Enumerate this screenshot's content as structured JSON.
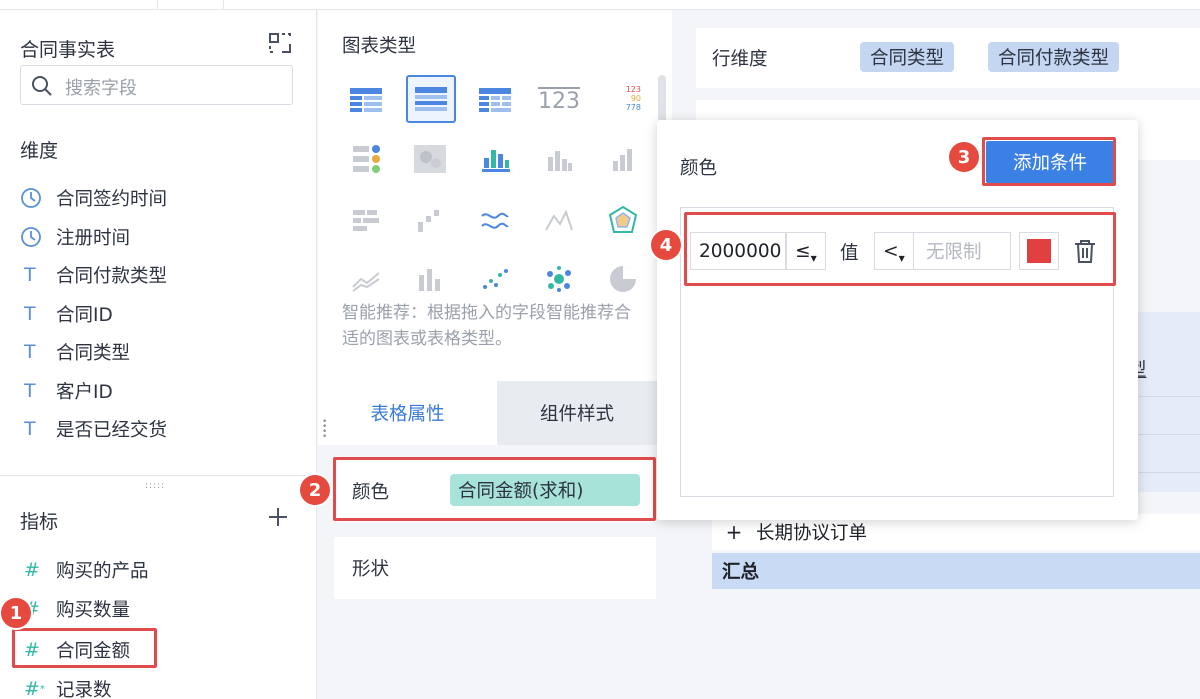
{
  "left_panel": {
    "title": "合同事实表",
    "search_placeholder": "搜索字段",
    "dimensions_header": "维度",
    "dimensions": [
      {
        "label": "合同签约时间",
        "type": "time"
      },
      {
        "label": "注册时间",
        "type": "time"
      },
      {
        "label": "合同付款类型",
        "type": "text"
      },
      {
        "label": "合同ID",
        "type": "text"
      },
      {
        "label": "合同类型",
        "type": "text"
      },
      {
        "label": "客户ID",
        "type": "text"
      },
      {
        "label": "是否已经交货",
        "type": "text"
      }
    ],
    "metrics_header": "指标",
    "metrics": [
      {
        "label": "购买的产品"
      },
      {
        "label": "购买数量"
      },
      {
        "label": "合同金额"
      },
      {
        "label": "记录数"
      }
    ]
  },
  "middle_panel": {
    "chart_types_title": "图表类型",
    "hint": "智能推荐：根据拖入的字段智能推荐合适的图表或表格类型。",
    "tabs": [
      "表格属性",
      "组件样式"
    ],
    "color_label": "颜色",
    "color_field": "合同金额(求和)",
    "shape_label": "形状",
    "mini_numbers": [
      "123",
      "90",
      "778"
    ],
    "number_icon_text": "123"
  },
  "right_panel": {
    "row_dimension_label": "行维度",
    "row_chips": [
      "合同类型",
      "合同付款类型"
    ],
    "partial_text": "型",
    "table_row_label": "长期协议订单",
    "expand_symbol": "+",
    "total_label": "汇总"
  },
  "popup": {
    "title": "颜色",
    "add_button": "添加条件",
    "condition": {
      "value": "2000000",
      "operator_left": "≤",
      "value_label": "值",
      "operator_right": "<",
      "upper_placeholder": "无限制",
      "color": "#e04040"
    }
  },
  "badges": [
    "1",
    "2",
    "3",
    "4"
  ],
  "colors": {
    "accent": "#3a80e5",
    "highlight_red": "#e04c4c",
    "metric_green": "#33b8a6",
    "dim_blue": "#5b8fd6",
    "chip_blue": "#c4d6f2",
    "pill_green": "#a7e3d8"
  }
}
